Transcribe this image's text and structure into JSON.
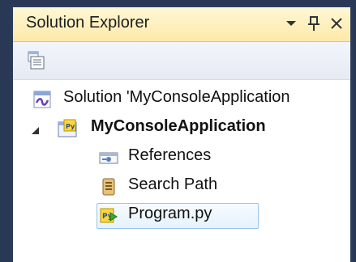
{
  "panel": {
    "title": "Solution Explorer",
    "buttons": {
      "dropdown_icon": "chevron-down-icon",
      "pin_icon": "pin-icon",
      "close_icon": "close-icon"
    }
  },
  "toolbar": {
    "properties_icon": "properties-icon"
  },
  "tree": {
    "solution": {
      "label": "Solution 'MyConsoleApplication",
      "icon": "solution-icon"
    },
    "project": {
      "label": "MyConsoleApplication",
      "icon": "python-project-icon",
      "expanded": true
    },
    "children": [
      {
        "label": "References",
        "icon": "references-icon"
      },
      {
        "label": "Search Path",
        "icon": "search-path-icon"
      },
      {
        "label": "Program.py",
        "icon": "python-file-icon",
        "selected": true
      }
    ]
  },
  "colors": {
    "accent_title": "#fde9a8",
    "frame": "#293955",
    "selection_border": "#9dc3ea"
  }
}
